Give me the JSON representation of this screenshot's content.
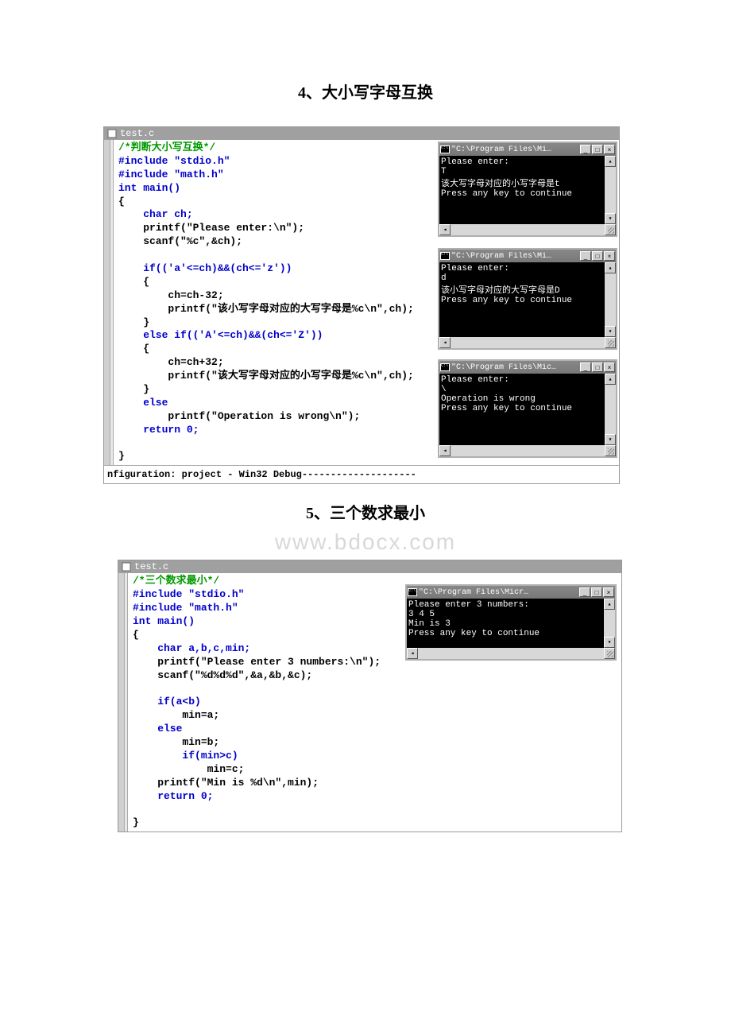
{
  "heading1": "4、大小写字母互换",
  "heading2": "5、三个数求最小",
  "watermark": "www.bdocx.com",
  "editor1": {
    "title": "test.c",
    "comment": "/*判断大小写互换*/",
    "lines": [
      {
        "cls": "c-keyword",
        "t": "#include \"stdio.h\""
      },
      {
        "cls": "c-keyword",
        "t": "#include \"math.h\""
      },
      {
        "cls": "c-keyword",
        "t": "int main()"
      },
      {
        "cls": "c-text",
        "t": "{"
      },
      {
        "cls": "c-keyword",
        "t": "    char ch;"
      },
      {
        "cls": "c-text",
        "t": "    printf(\"Please enter:\\n\");"
      },
      {
        "cls": "c-text",
        "t": "    scanf(\"%c\",&ch);"
      },
      {
        "cls": "c-text",
        "t": ""
      },
      {
        "cls": "c-keyword",
        "t": "    if(('a'<=ch)&&(ch<='z'))"
      },
      {
        "cls": "c-text",
        "t": "    {"
      },
      {
        "cls": "c-text",
        "t": "        ch=ch-32;"
      },
      {
        "cls": "c-text",
        "t": "        printf(\"该小写字母对应的大写字母是%c\\n\",ch);"
      },
      {
        "cls": "c-text",
        "t": "    }"
      },
      {
        "cls": "c-keyword",
        "t": "    else if(('A'<=ch)&&(ch<='Z'))"
      },
      {
        "cls": "c-text",
        "t": "    {"
      },
      {
        "cls": "c-text",
        "t": "        ch=ch+32;"
      },
      {
        "cls": "c-text",
        "t": "        printf(\"该大写字母对应的小写字母是%c\\n\",ch);"
      },
      {
        "cls": "c-text",
        "t": "    }"
      },
      {
        "cls": "c-keyword",
        "t": "    else"
      },
      {
        "cls": "c-text",
        "t": "        printf(\"Operation is wrong\\n\");"
      },
      {
        "cls": "c-keyword",
        "t": "    return 0;"
      },
      {
        "cls": "c-text",
        "t": ""
      },
      {
        "cls": "c-text",
        "t": "}"
      }
    ],
    "footer": "nfiguration: project - Win32 Debug--------------------"
  },
  "console1": {
    "title": "\"C:\\Program Files\\Mi…",
    "lines": [
      "Please enter:",
      "T",
      "该大写字母对应的小写字母是t",
      "Press any key to continue"
    ]
  },
  "console2": {
    "title": "\"C:\\Program Files\\Mi…",
    "lines": [
      "Please enter:",
      "d",
      "该小写字母对应的大写字母是D",
      "Press any key to continue"
    ]
  },
  "console3": {
    "title": "\"C:\\Program Files\\Mic…",
    "lines": [
      "Please enter:",
      "\\",
      "Operation is wrong",
      "Press any key to continue"
    ]
  },
  "editor2": {
    "title": "test.c",
    "comment": "/*三个数求最小*/",
    "lines": [
      {
        "cls": "c-keyword",
        "t": "#include \"stdio.h\""
      },
      {
        "cls": "c-keyword",
        "t": "#include \"math.h\""
      },
      {
        "cls": "c-keyword",
        "t": "int main()"
      },
      {
        "cls": "c-text",
        "t": "{"
      },
      {
        "cls": "c-keyword",
        "t": "    char a,b,c,min;"
      },
      {
        "cls": "c-text",
        "t": "    printf(\"Please enter 3 numbers:\\n\");"
      },
      {
        "cls": "c-text",
        "t": "    scanf(\"%d%d%d\",&a,&b,&c);"
      },
      {
        "cls": "c-text",
        "t": ""
      },
      {
        "cls": "c-keyword",
        "t": "    if(a<b)"
      },
      {
        "cls": "c-text",
        "t": "        min=a;"
      },
      {
        "cls": "c-keyword",
        "t": "    else"
      },
      {
        "cls": "c-text",
        "t": "        min=b;"
      },
      {
        "cls": "c-keyword",
        "t": "        if(min>c)"
      },
      {
        "cls": "c-text",
        "t": "            min=c;"
      },
      {
        "cls": "c-text",
        "t": "    printf(\"Min is %d\\n\",min);"
      },
      {
        "cls": "c-keyword",
        "t": "    return 0;"
      },
      {
        "cls": "c-text",
        "t": ""
      },
      {
        "cls": "c-text",
        "t": "}"
      }
    ]
  },
  "console4": {
    "title": "\"C:\\Program Files\\Micr…",
    "lines": [
      "Please enter 3 numbers:",
      "3 4 5",
      "Min is 3",
      "Press any key to continue"
    ]
  },
  "btns": {
    "min": "_",
    "max": "□",
    "close": "×",
    "up": "▴",
    "down": "▾",
    "left": "◂",
    "right": "▸"
  }
}
